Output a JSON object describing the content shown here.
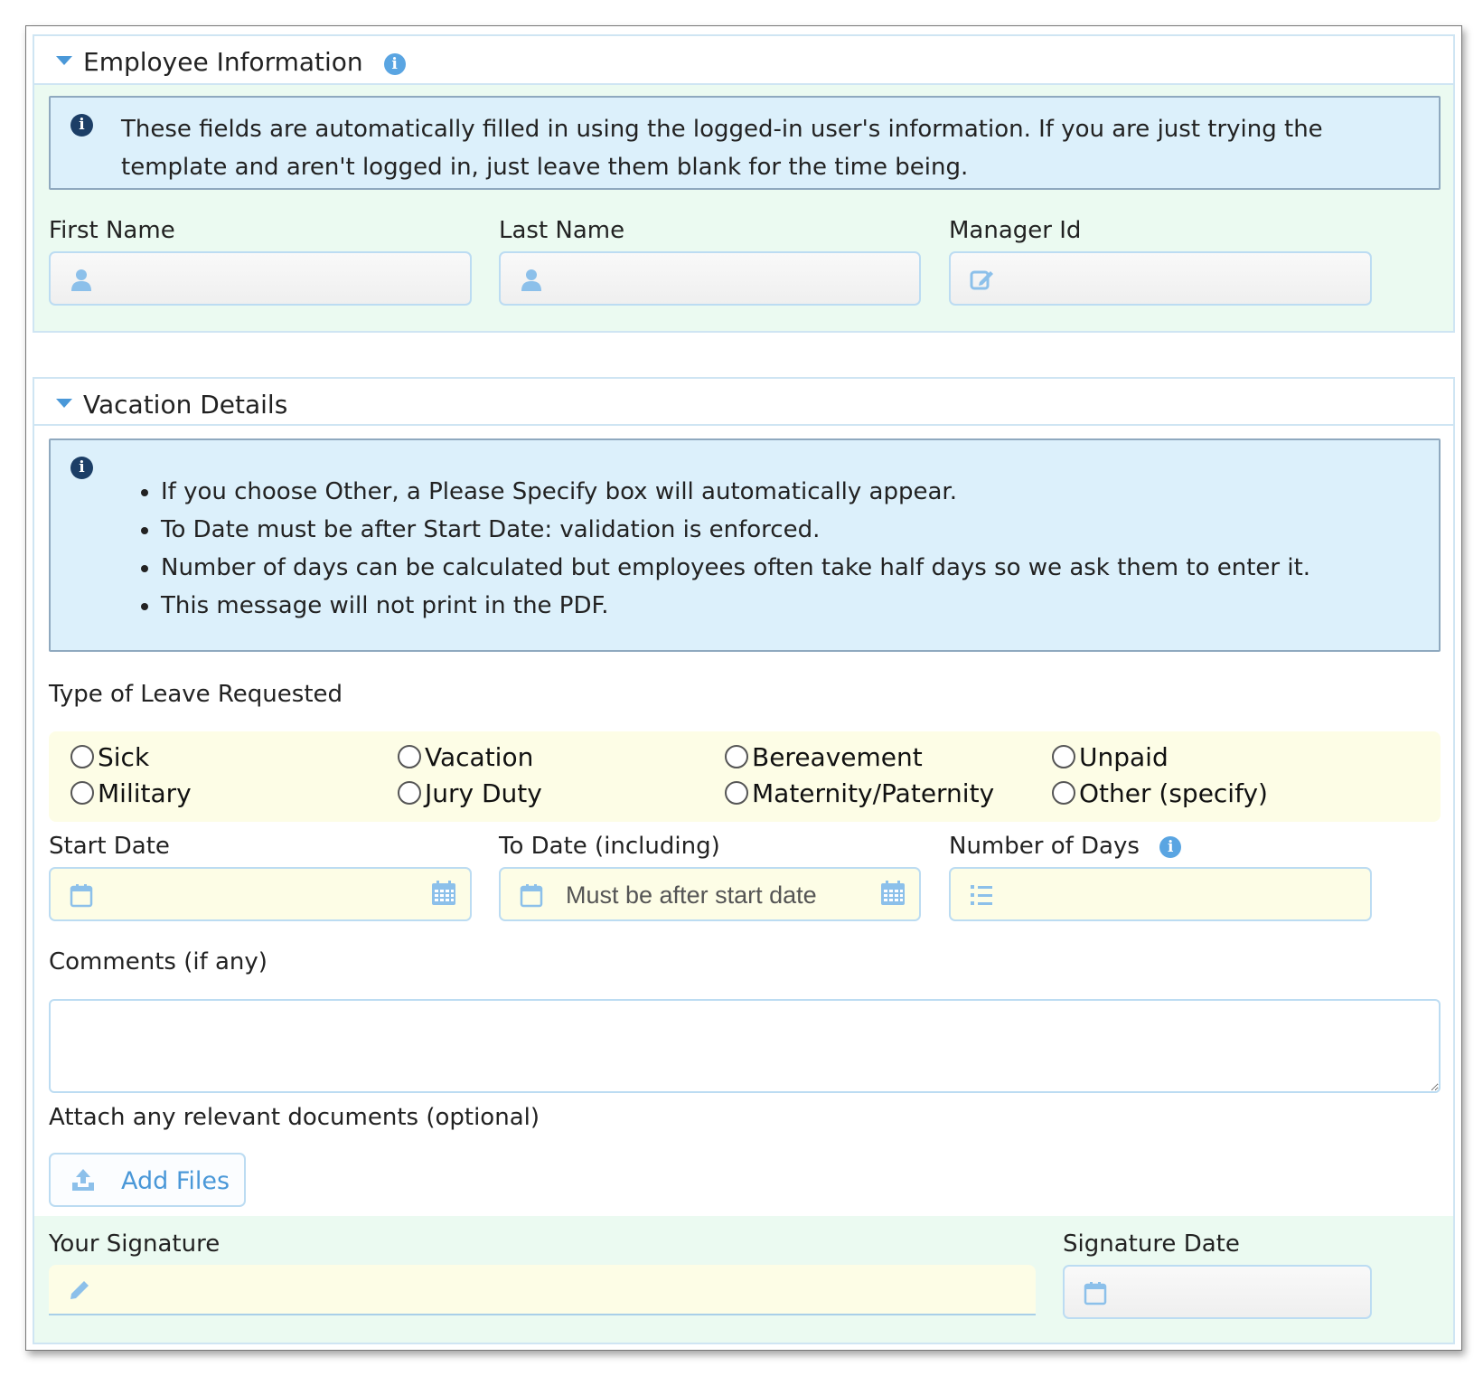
{
  "employee_section": {
    "title": "Employee Information",
    "alert_text": "These fields are automatically filled in using the logged-in user's information. If you are just trying the template and aren't logged in, just leave them blank for the time being.",
    "first_name_label": "First Name",
    "first_name_value": "",
    "last_name_label": "Last Name",
    "last_name_value": "",
    "manager_id_label": "Manager Id",
    "manager_id_value": ""
  },
  "vacation_section": {
    "title": "Vacation Details",
    "alert_items": [
      "If you choose Other, a Please Specify box will automatically appear.",
      "To Date must be after Start Date: validation is enforced.",
      "Number of days can be calculated but employees often take half days so we ask them to enter it.",
      "This message will not print in the PDF."
    ],
    "leave_type_label": "Type of Leave Requested",
    "leave_options": [
      "Sick",
      "Vacation",
      "Bereavement",
      "Unpaid",
      "Military",
      "Jury Duty",
      "Maternity/Paternity",
      "Other (specify)"
    ],
    "leave_selected": null,
    "start_date_label": "Start Date",
    "start_date_value": "",
    "to_date_label": "To Date (including)",
    "to_date_placeholder": "Must be after start date",
    "num_days_label": "Number of Days",
    "num_days_value": "",
    "comments_label": "Comments (if any)",
    "comments_value": "",
    "attach_label": "Attach any relevant documents (optional)",
    "add_files_label": "Add Files",
    "signature_label": "Your Signature",
    "signature_date_label": "Signature Date"
  },
  "colors": {
    "accent": "#4a98d8",
    "section_border": "#cfe5f3",
    "green_bg": "#ebfaf1",
    "alert_bg": "#dcf0fb",
    "yellow_bg": "#fdfde6"
  }
}
